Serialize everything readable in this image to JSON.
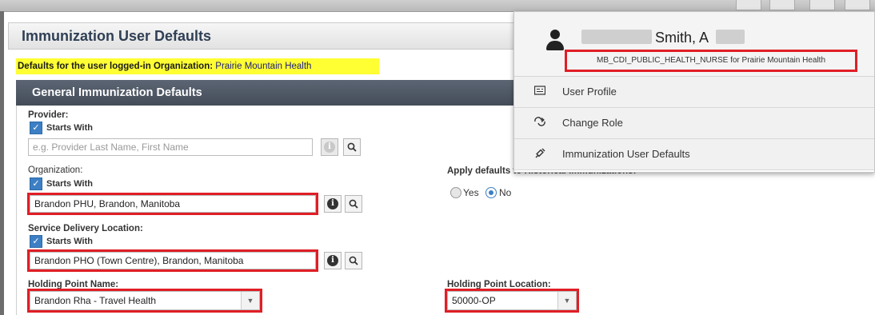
{
  "page": {
    "title": "Immunization User Defaults"
  },
  "notice": {
    "label": "Defaults for the user logged-in Organization:",
    "organization": "Prairie Mountain Health"
  },
  "section": {
    "title": "General Immunization Defaults"
  },
  "provider": {
    "label": "Provider:",
    "starts_with": "Starts With",
    "placeholder": "e.g. Provider Last Name, First Name",
    "value": ""
  },
  "organization": {
    "label": "Organization:",
    "starts_with": "Starts With",
    "value": "Brandon PHU, Brandon, Manitoba"
  },
  "service_delivery_location": {
    "label": "Service Delivery Location:",
    "starts_with": "Starts With",
    "value": "Brandon PHO (Town Centre), Brandon, Manitoba"
  },
  "historical": {
    "label": "Apply defaults to Historical Immunizations:",
    "options": [
      "Yes",
      "No"
    ],
    "selected": "No"
  },
  "holding_point_name": {
    "label": "Holding Point Name:",
    "value": "Brandon Rha - Travel Health"
  },
  "holding_point_location": {
    "label": "Holding Point Location:",
    "value": "50000-OP"
  },
  "user_menu": {
    "user_name": "Smith, A",
    "role": "MB_CDI_PUBLIC_HEALTH_NURSE for Prairie Mountain Health",
    "items": [
      {
        "label": "User Profile",
        "icon": "id-card-icon"
      },
      {
        "label": "Change Role",
        "icon": "swap-arrows-icon"
      },
      {
        "label": "Immunization User Defaults",
        "icon": "syringe-icon"
      }
    ]
  },
  "colors": {
    "highlight": "#ffff33",
    "annotation": "#e01e26",
    "header": "#4a5260",
    "accent": "#3d7fc4"
  }
}
